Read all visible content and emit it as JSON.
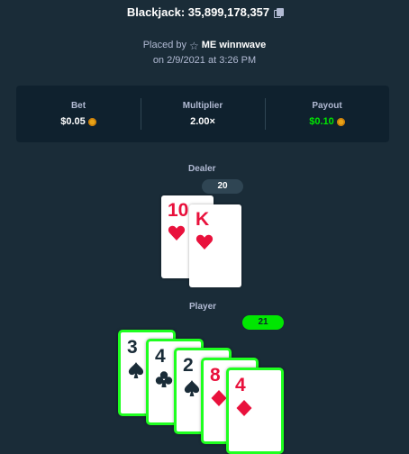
{
  "header": {
    "title": "Blackjack: 35,899,178,357",
    "copy_icon": "copy-icon"
  },
  "placed": {
    "prefix": "Placed by",
    "user_icon": "star-icon",
    "username": "ME winnwave",
    "date": "on 2/9/2021 at 3:26 PM"
  },
  "stats": {
    "bet_label": "Bet",
    "bet_value": "$0.05",
    "multiplier_label": "Multiplier",
    "multiplier_value": "2.00×",
    "payout_label": "Payout",
    "payout_value": "$0.10",
    "currency_icon": "coin-icon"
  },
  "colors": {
    "background": "#1a2c38",
    "panel": "#0f212e",
    "win_green": "#00e701",
    "card_red": "#e9113c",
    "card_dark": "#1a2c38"
  },
  "dealer": {
    "label": "Dealer",
    "score": "20",
    "cards": [
      {
        "rank": "10",
        "suit": "hearts"
      },
      {
        "rank": "K",
        "suit": "hearts"
      }
    ]
  },
  "player": {
    "label": "Player",
    "score": "21",
    "cards": [
      {
        "rank": "3",
        "suit": "spades"
      },
      {
        "rank": "4",
        "suit": "clubs"
      },
      {
        "rank": "2",
        "suit": "spades"
      },
      {
        "rank": "8",
        "suit": "diamonds"
      },
      {
        "rank": "4",
        "suit": "diamonds"
      }
    ]
  }
}
